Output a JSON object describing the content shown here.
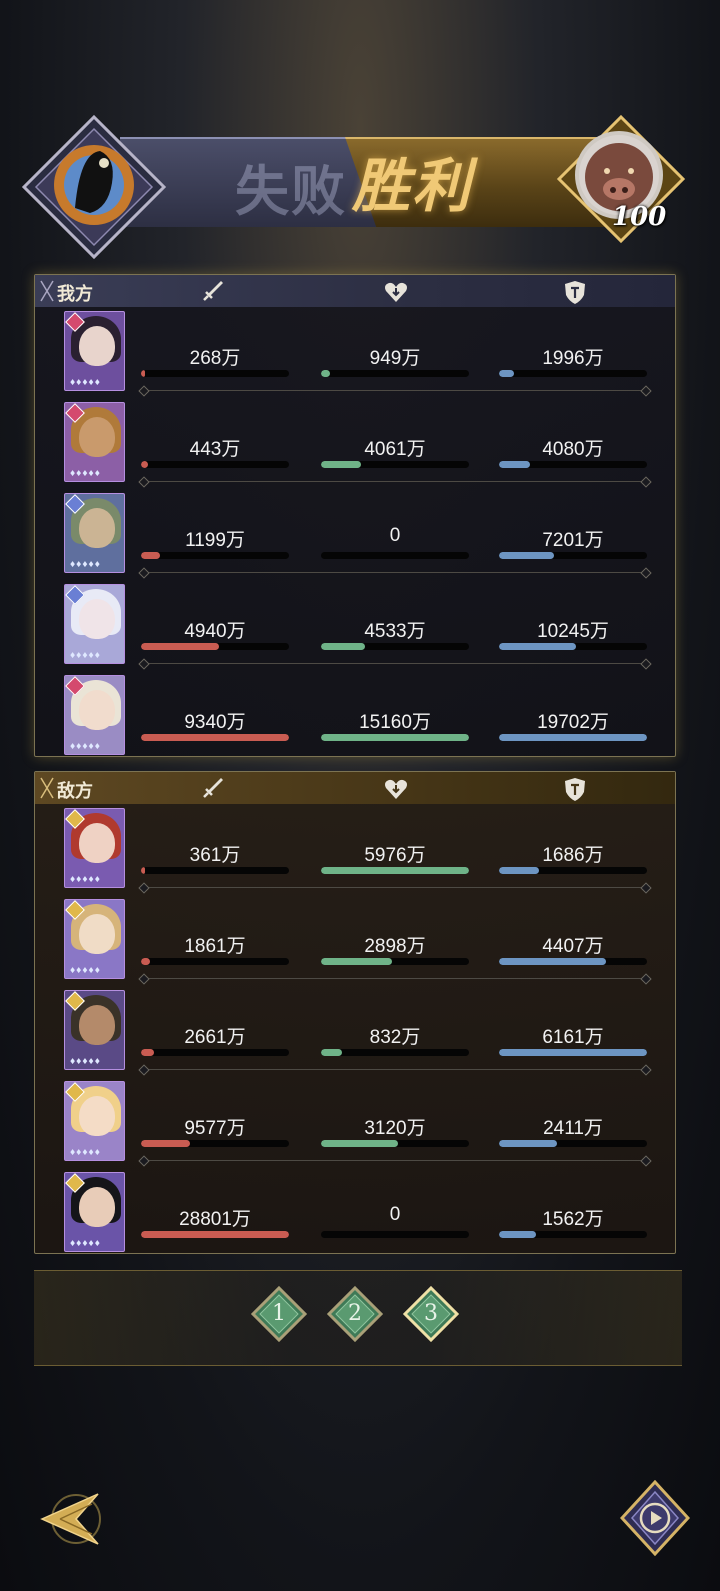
{
  "header": {
    "lose_label": "失败",
    "win_label": "胜利",
    "enemy_level": "100"
  },
  "ally": {
    "title": "我方",
    "rows": [
      {
        "attack": "268万",
        "heal": "949万",
        "tank": "1996万",
        "attack_ratio": 0.03,
        "heal_ratio": 0.06,
        "tank_ratio": 0.1
      },
      {
        "attack": "443万",
        "heal": "4061万",
        "tank": "4080万",
        "attack_ratio": 0.05,
        "heal_ratio": 0.27,
        "tank_ratio": 0.21
      },
      {
        "attack": "1199万",
        "heal": "0",
        "tank": "7201万",
        "attack_ratio": 0.13,
        "heal_ratio": 0.0,
        "tank_ratio": 0.37
      },
      {
        "attack": "4940万",
        "heal": "4533万",
        "tank": "10245万",
        "attack_ratio": 0.53,
        "heal_ratio": 0.3,
        "tank_ratio": 0.52
      },
      {
        "attack": "9340万",
        "heal": "15160万",
        "tank": "19702万",
        "attack_ratio": 1.0,
        "heal_ratio": 1.0,
        "tank_ratio": 1.0
      }
    ]
  },
  "enemy": {
    "title": "敌方",
    "rows": [
      {
        "attack": "361万",
        "heal": "5976万",
        "tank": "1686万",
        "attack_ratio": 0.01,
        "heal_ratio": 1.0,
        "tank_ratio": 0.27
      },
      {
        "attack": "1861万",
        "heal": "2898万",
        "tank": "4407万",
        "attack_ratio": 0.06,
        "heal_ratio": 0.48,
        "tank_ratio": 0.72
      },
      {
        "attack": "2661万",
        "heal": "832万",
        "tank": "6161万",
        "attack_ratio": 0.09,
        "heal_ratio": 0.14,
        "tank_ratio": 1.0
      },
      {
        "attack": "9577万",
        "heal": "3120万",
        "tank": "2411万",
        "attack_ratio": 0.33,
        "heal_ratio": 0.52,
        "tank_ratio": 0.39
      },
      {
        "attack": "28801万",
        "heal": "0",
        "tank": "1562万",
        "attack_ratio": 1.0,
        "heal_ratio": 0.0,
        "tank_ratio": 0.25
      }
    ]
  },
  "round_tabs": [
    {
      "label": "1",
      "selected": false
    },
    {
      "label": "2",
      "selected": false
    },
    {
      "label": "3",
      "selected": true
    }
  ],
  "icons": {
    "attack": "sword-icon",
    "heal": "heart-icon",
    "tank": "shield-icon",
    "back": "back-arrow-icon",
    "replay": "replay-icon"
  },
  "colors": {
    "attack_bar": "#c95c52",
    "heal_bar": "#6fb388",
    "tank_bar": "#6d95c2",
    "win_gold": "#f0c976"
  }
}
